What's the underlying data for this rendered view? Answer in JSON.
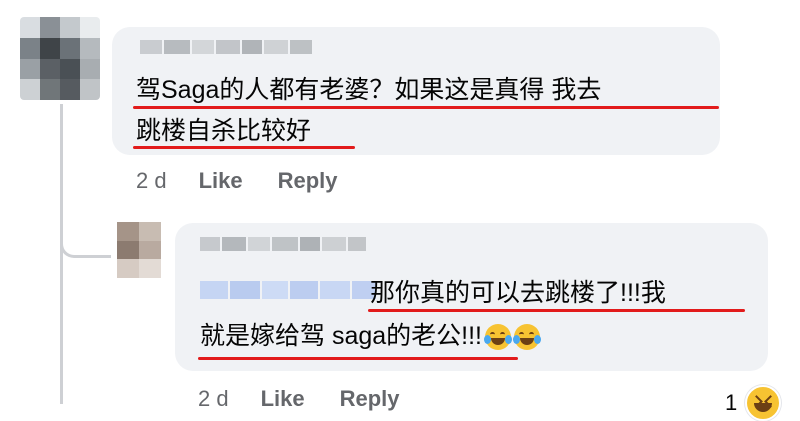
{
  "comments": [
    {
      "text_line1": "驾Saga的人都有老婆？如果这是真得 我去",
      "text_line2": "跳楼自杀比较好",
      "timestamp": "2 d",
      "like_label": "Like",
      "reply_label": "Reply"
    },
    {
      "text_line1": "那你真的可以去跳楼了!!!我",
      "text_line2": "就是嫁给驾 saga的老公!!!",
      "timestamp": "2 d",
      "like_label": "Like",
      "reply_label": "Reply",
      "reaction_count": "1",
      "reaction_icon": "grinning-squinting-face-icon",
      "inline_emoji": "face-with-tears-of-joy-icon"
    }
  ],
  "colors": {
    "bubble": "#f0f2f5",
    "underline": "#e21b1b",
    "action_text": "#65676b",
    "mention_blur": "#c5d5f3"
  }
}
